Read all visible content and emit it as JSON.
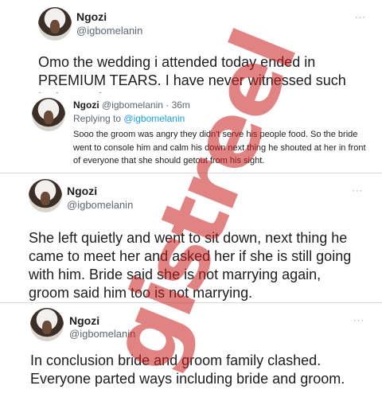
{
  "tweet1": {
    "name": "Ngozi",
    "handle": "@igbomelanin",
    "more": "···",
    "text": "Omo the wedding i attended today ended in PREMIUM TEARS. I have never witnessed such before wtf!!!",
    "quoted": {
      "name": "Ngozi",
      "meta": "@igbomelanin · 36m",
      "reply_prefix": "Replying to",
      "reply_handle": "@igbomelanin",
      "text": "Sooo the groom was angry they didn't serve his people food. So the bride went to console him and calm his down next thing he shouted at her in front of everyone that she should getout from his sight."
    }
  },
  "tweet2": {
    "name": "Ngozi",
    "handle": "@igbomelanin",
    "more": "···",
    "text": "She left quietly and went to sit down, next thing he came to meet her and asked her if she is still going with him. Bride said she is not marrying again, groom said him too is not marrying."
  },
  "tweet3": {
    "name": "Ngozi",
    "handle": "@igbomelanin",
    "more": "···",
    "text": "In conclusion bride and groom family clashed. Everyone parted ways including bride and groom."
  },
  "watermark": "gistreel"
}
